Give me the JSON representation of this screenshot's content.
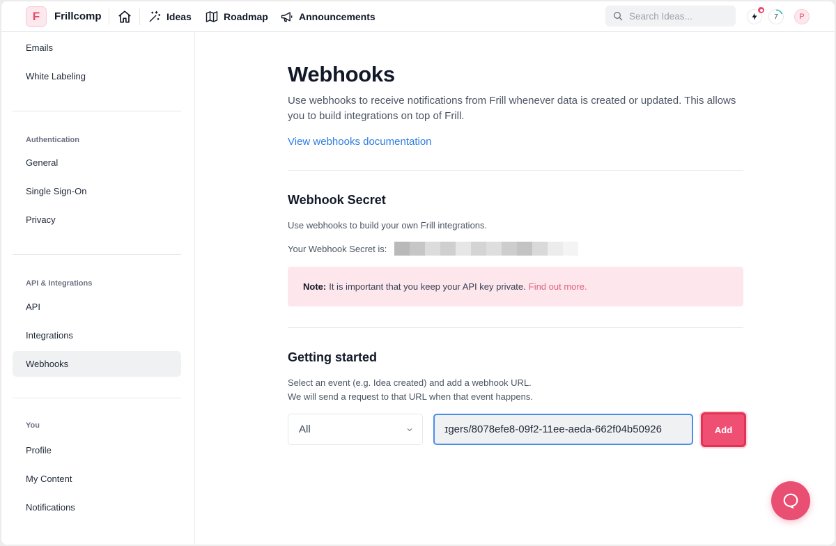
{
  "header": {
    "logo_letter": "F",
    "brand": "Frillcomp",
    "nav": [
      {
        "label": "Ideas",
        "icon": "sparkles-icon"
      },
      {
        "label": "Roadmap",
        "icon": "map-icon"
      },
      {
        "label": "Announcements",
        "icon": "megaphone-icon"
      }
    ],
    "search_placeholder": "Search Ideas...",
    "badge_count": "7",
    "avatar_letter": "P"
  },
  "sidebar": {
    "groups": [
      {
        "heading": "",
        "items": [
          "Emails",
          "White Labeling"
        ]
      },
      {
        "heading": "Authentication",
        "items": [
          "General",
          "Single Sign-On",
          "Privacy"
        ]
      },
      {
        "heading": "API & Integrations",
        "items": [
          "API",
          "Integrations",
          "Webhooks"
        ]
      },
      {
        "heading": "You",
        "items": [
          "Profile",
          "My Content",
          "Notifications"
        ]
      }
    ],
    "active_item": "Webhooks"
  },
  "main": {
    "title": "Webhooks",
    "lead": "Use webhooks to receive notifications from Frill whenever data is created or updated. This allows you to build integrations on top of Frill.",
    "doc_link": "View webhooks documentation",
    "secret_section": {
      "title": "Webhook Secret",
      "description": "Use webhooks to build your own Frill integrations.",
      "secret_label": "Your Webhook Secret is:",
      "note_bold": "Note:",
      "note_text": "It is important that you keep your API key private.",
      "note_link": "Find out more."
    },
    "getting_started": {
      "title": "Getting started",
      "line1": "Select an event (e.g. Idea created) and add a webhook URL.",
      "line2": "We will send a request to that URL when that event happens.",
      "event_select_value": "All",
      "url_value": "ɪgers/8078efe8-09f2-11ee-aeda-662f04b50926",
      "add_label": "Add"
    }
  },
  "colors": {
    "accent": "#e94868",
    "link": "#2f7de1",
    "note_bg": "#fde7ec"
  }
}
